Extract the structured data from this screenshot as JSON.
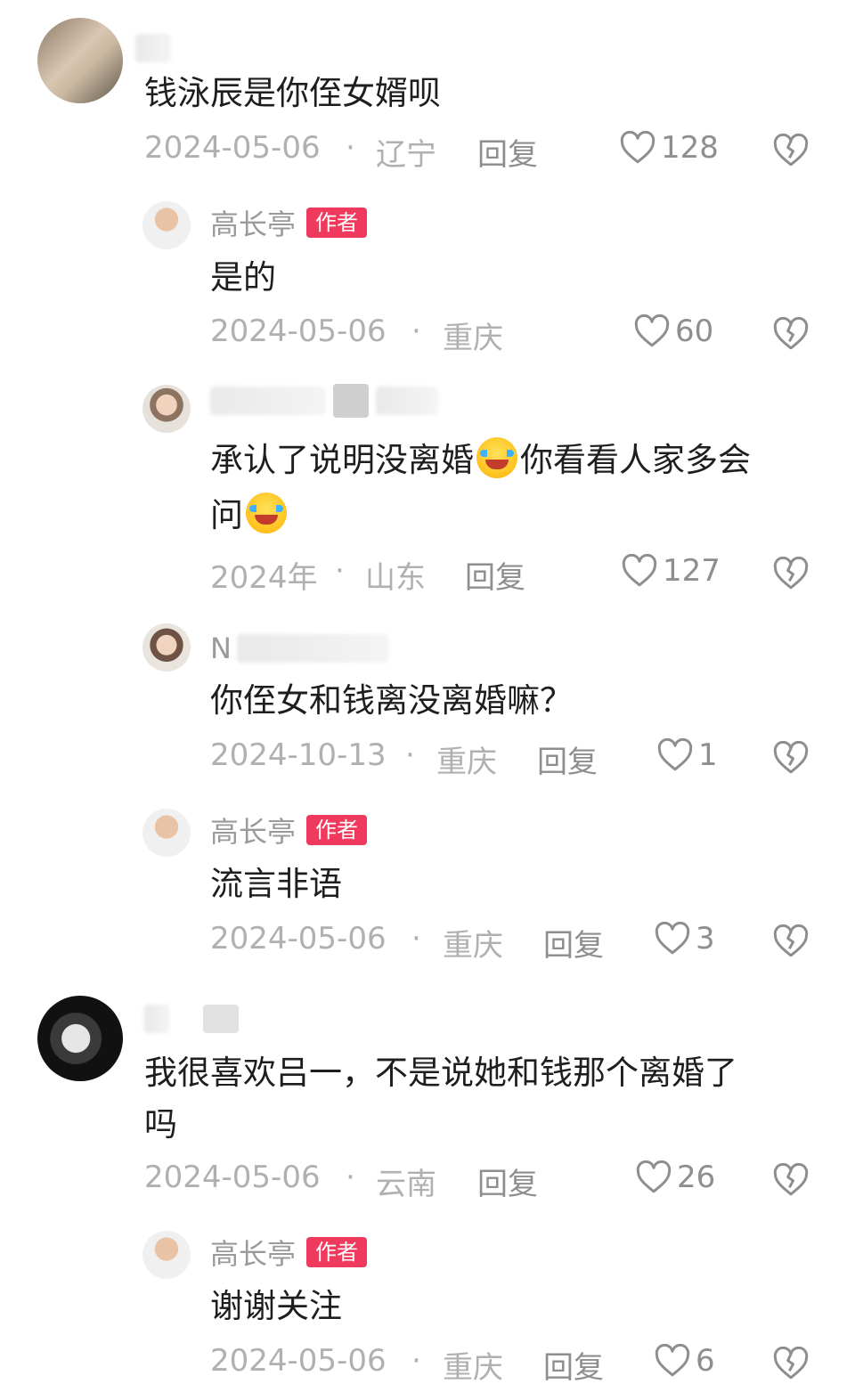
{
  "labels": {
    "reply": "回复",
    "author_badge": "作者"
  },
  "comments": [
    {
      "name": "",
      "text": "钱泳辰是你侄女婿呗",
      "date": "2024-05-06",
      "location": "辽宁",
      "likes": "128"
    },
    {
      "name": "高长亭",
      "text": "是的",
      "date": "2024-05-06",
      "location": "重庆",
      "likes": "60"
    },
    {
      "name": "",
      "text_line1a": "承认了说明没离婚",
      "text_line1b": "你看看人家多会",
      "text_line2": "问",
      "date": "2024年",
      "location": "山东",
      "likes": "127"
    },
    {
      "name": "N",
      "text": "你侄女和钱离没离婚嘛？",
      "date": "2024-10-13",
      "location": "重庆",
      "likes": "1"
    },
    {
      "name": "高长亭",
      "text": "流言非语",
      "date": "2024-05-06",
      "location": "重庆",
      "likes": "3"
    },
    {
      "name": "",
      "text_line1": "我很喜欢吕一，不是说她和钱那个离婚了",
      "text_line2": "吗",
      "date": "2024-05-06",
      "location": "云南",
      "likes": "26"
    },
    {
      "name": "高长亭",
      "text": "谢谢关注",
      "date": "2024-05-06",
      "location": "重庆",
      "likes": "6"
    }
  ],
  "icons": {
    "like": "heart-outline-icon",
    "dislike": "broken-heart-icon"
  },
  "colors": {
    "badge": "#ef3a5d",
    "meta": "#b0b0b0",
    "text": "#1e1e1e"
  }
}
